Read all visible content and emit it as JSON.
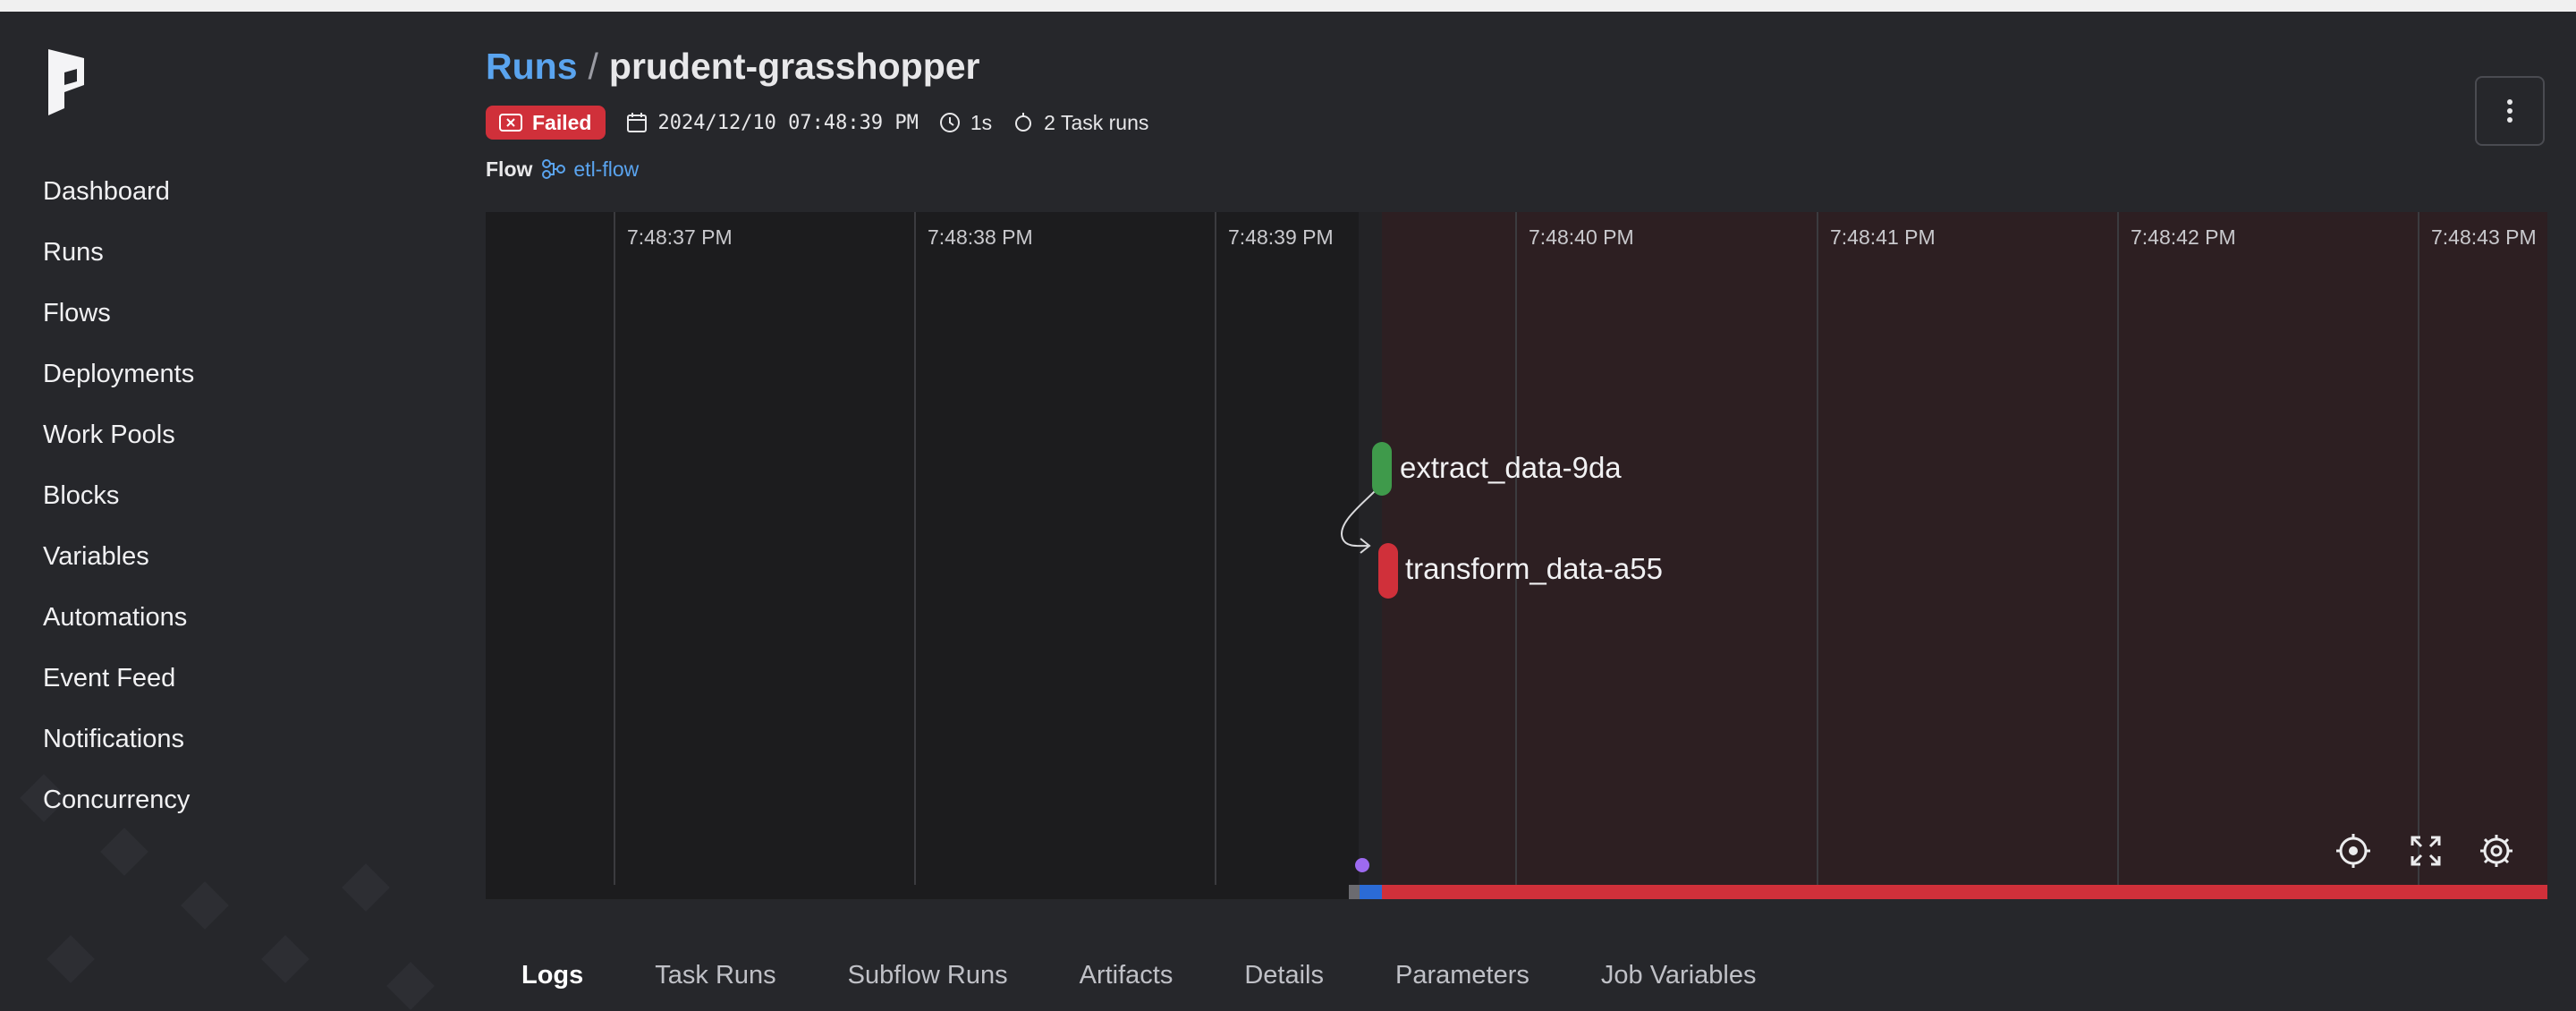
{
  "sidebar": {
    "items": [
      {
        "label": "Dashboard"
      },
      {
        "label": "Runs"
      },
      {
        "label": "Flows"
      },
      {
        "label": "Deployments"
      },
      {
        "label": "Work Pools"
      },
      {
        "label": "Blocks"
      },
      {
        "label": "Variables"
      },
      {
        "label": "Automations"
      },
      {
        "label": "Event Feed"
      },
      {
        "label": "Notifications"
      },
      {
        "label": "Concurrency"
      }
    ]
  },
  "header": {
    "breadcrumb_root": "Runs",
    "separator": "/",
    "run_name": "prudent-grasshopper"
  },
  "meta": {
    "state": "Failed",
    "state_color": "#d0303a",
    "start_time": "2024/12/10 07:48:39 PM",
    "duration": "1s",
    "task_runs": "2 Task runs"
  },
  "flow": {
    "label": "Flow",
    "name": "etl-flow"
  },
  "timeline": {
    "ticks": [
      "7:48:37 PM",
      "7:48:38 PM",
      "7:48:39 PM",
      "7:48:40 PM",
      "7:48:41 PM",
      "7:48:42 PM",
      "7:48:43 PM"
    ],
    "nodes": [
      {
        "name": "extract_data-9da",
        "state_color": "#3f9a4b"
      },
      {
        "name": "transform_data-a55",
        "state_color": "#d0303a"
      }
    ]
  },
  "tabs": [
    {
      "label": "Logs",
      "active": true
    },
    {
      "label": "Task Runs"
    },
    {
      "label": "Subflow Runs"
    },
    {
      "label": "Artifacts"
    },
    {
      "label": "Details"
    },
    {
      "label": "Parameters"
    },
    {
      "label": "Job Variables"
    }
  ],
  "colors": {
    "accent": "#5aa4ef",
    "failed": "#d0303a",
    "completed": "#3f9a4b"
  }
}
